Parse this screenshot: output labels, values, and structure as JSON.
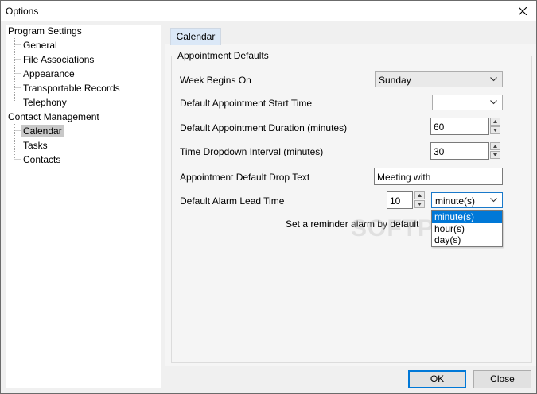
{
  "window": {
    "title": "Options"
  },
  "tree": {
    "groups": [
      {
        "label": "Program Settings",
        "children": [
          "General",
          "File Associations",
          "Appearance",
          "Transportable Records",
          "Telephony"
        ]
      },
      {
        "label": "Contact Management",
        "children": [
          "Calendar",
          "Tasks",
          "Contacts"
        ]
      }
    ],
    "selected": "Calendar"
  },
  "tab": {
    "label": "Calendar"
  },
  "group": {
    "title": "Appointment Defaults",
    "week_begins": {
      "label": "Week Begins On",
      "value": "Sunday"
    },
    "start_time": {
      "label": "Default Appointment Start Time",
      "value": ""
    },
    "duration": {
      "label": "Default Appointment Duration (minutes)",
      "value": "60"
    },
    "interval": {
      "label": "Time Dropdown Interval (minutes)",
      "value": "30"
    },
    "drop_text": {
      "label": "Appointment Default Drop Text",
      "value": "Meeting with"
    },
    "alarm": {
      "label": "Default Alarm Lead Time",
      "value": "10",
      "unit": "minute(s)",
      "options": [
        "minute(s)",
        "hour(s)",
        "day(s)"
      ]
    },
    "reminder_text": "Set a reminder alarm by default"
  },
  "watermark": "SOFTPEDIA",
  "buttons": {
    "ok": "OK",
    "close": "Close"
  },
  "colors": {
    "selection": "#0078d7",
    "tab": "#dbe8f7",
    "tree_selected": "#c8c8c8"
  }
}
